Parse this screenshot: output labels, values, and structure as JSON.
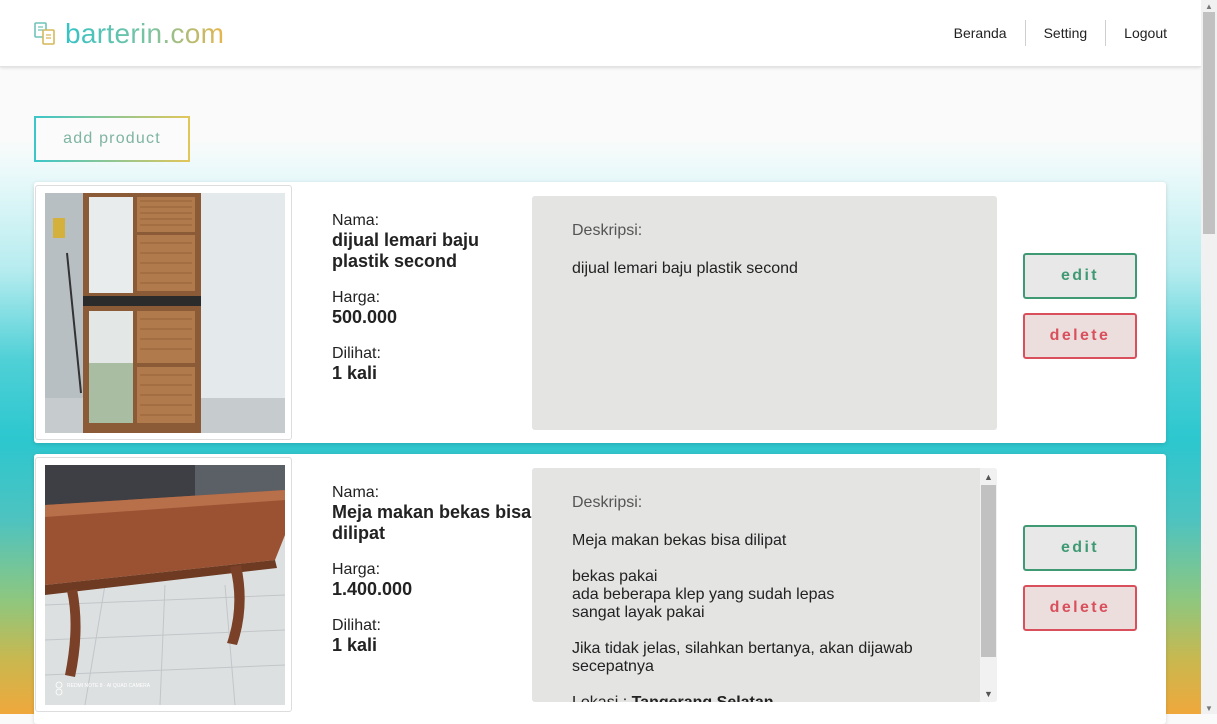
{
  "brand": {
    "name": "barterin.com",
    "logo_icon": "swap-cards-icon"
  },
  "nav": {
    "home": "Beranda",
    "setting": "Setting",
    "logout": "Logout"
  },
  "add_product_label": "add product",
  "labels": {
    "name": "Nama:",
    "price": "Harga:",
    "views": "Dilihat:",
    "description": "Deskripsi:"
  },
  "buttons": {
    "edit": "edit",
    "delete": "delete"
  },
  "products": [
    {
      "name": "dijual lemari baju plastik second",
      "price": "500.000",
      "views": "1 kali",
      "description_lines": [
        "dijual lemari baju plastik second"
      ]
    },
    {
      "name": "Meja makan bekas bisa dilipat",
      "price": "1.400.000",
      "views": "1 kali",
      "description_lines": [
        "Meja makan bekas bisa dilipat",
        "",
        "bekas pakai",
        "ada beberapa klep yang sudah lepas",
        "sangat layak pakai",
        "",
        "Jika tidak jelas, silahkan bertanya, akan dijawab",
        "secepatnya",
        ""
      ],
      "location_label": "Lokasi :",
      "location_value": "Tangerang Selatan",
      "photo_watermark": "REDMI NOTE 8 · AI QUAD CAMERA"
    }
  ],
  "colors": {
    "edit": "#3f9a74",
    "delete": "#d9505c",
    "brand_start": "#35c3c5",
    "brand_end": "#e8b54a"
  }
}
